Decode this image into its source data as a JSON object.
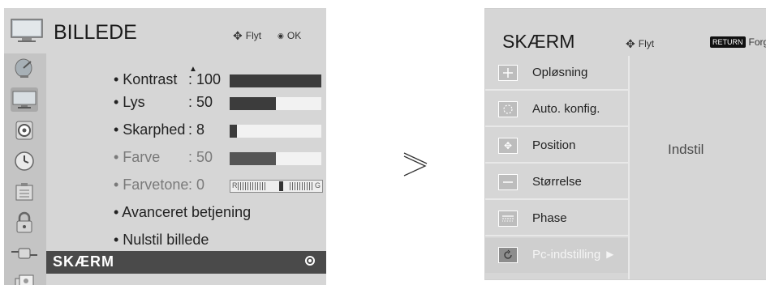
{
  "left": {
    "title": "BILLEDE",
    "hint_move": "Flyt",
    "hint_ok": "OK",
    "rows": [
      {
        "label": "• Kontrast",
        "value": ": 100",
        "level": 100
      },
      {
        "label": "• Lys",
        "value": ": 50",
        "level": 50
      },
      {
        "label": "• Skarphed",
        "value": ": 8",
        "level": 8
      },
      {
        "label": "• Farve",
        "value": ": 50",
        "level": 50
      },
      {
        "label": "• Farvetone",
        "value": ": 0",
        "tint_left": "R",
        "tint_right": "G",
        "level": 0
      },
      {
        "label": "• Avanceret betjening"
      },
      {
        "label": "• Nulstil billede"
      }
    ],
    "selected": "SKÆRM",
    "side_icons": [
      "satellite-dish-icon",
      "tv-monitor-icon",
      "speaker-icon",
      "clock-icon",
      "settings-box-icon",
      "lock-icon",
      "plug-icon",
      "media-icon"
    ]
  },
  "right": {
    "title": "SKÆRM",
    "hint_move": "Flyt",
    "return_key": "RETURN",
    "return_label": "Forg.",
    "items": [
      {
        "label": "Opløsning"
      },
      {
        "label": "Auto. konfig."
      },
      {
        "label": "Position"
      },
      {
        "label": "Størrelse"
      },
      {
        "label": "Phase"
      },
      {
        "label": "Pc-indstilling  ►"
      }
    ],
    "sub_label": "Indstil"
  }
}
